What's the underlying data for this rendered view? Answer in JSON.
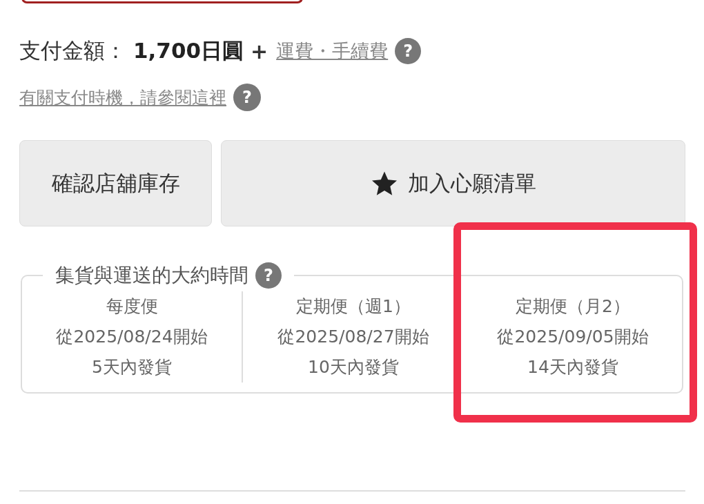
{
  "payment": {
    "label": "支付金額：",
    "amount": "1,700日圓",
    "plus": "+",
    "fee_link": "運費・手續費",
    "help": "?"
  },
  "timing_link": {
    "text": "有關支付時機，請參閱這裡",
    "help": "?"
  },
  "buttons": [
    {
      "kind": "plain",
      "label": "確認店舖庫存"
    },
    {
      "kind": "star",
      "label": "加入心願清單"
    }
  ],
  "shipping": {
    "title": "集貨與運送的大約時間",
    "help": "?",
    "options": [
      {
        "name": "每度便",
        "start": "從2025/08/24開始",
        "lead": "5天內發貨",
        "highlighted": false
      },
      {
        "name": "定期便（週1）",
        "start": "從2025/08/27開始",
        "lead": "10天內發貨",
        "highlighted": false
      },
      {
        "name": "定期便（月2）",
        "start": "從2025/09/05開始",
        "lead": "14天內發貨",
        "highlighted": true
      }
    ]
  }
}
